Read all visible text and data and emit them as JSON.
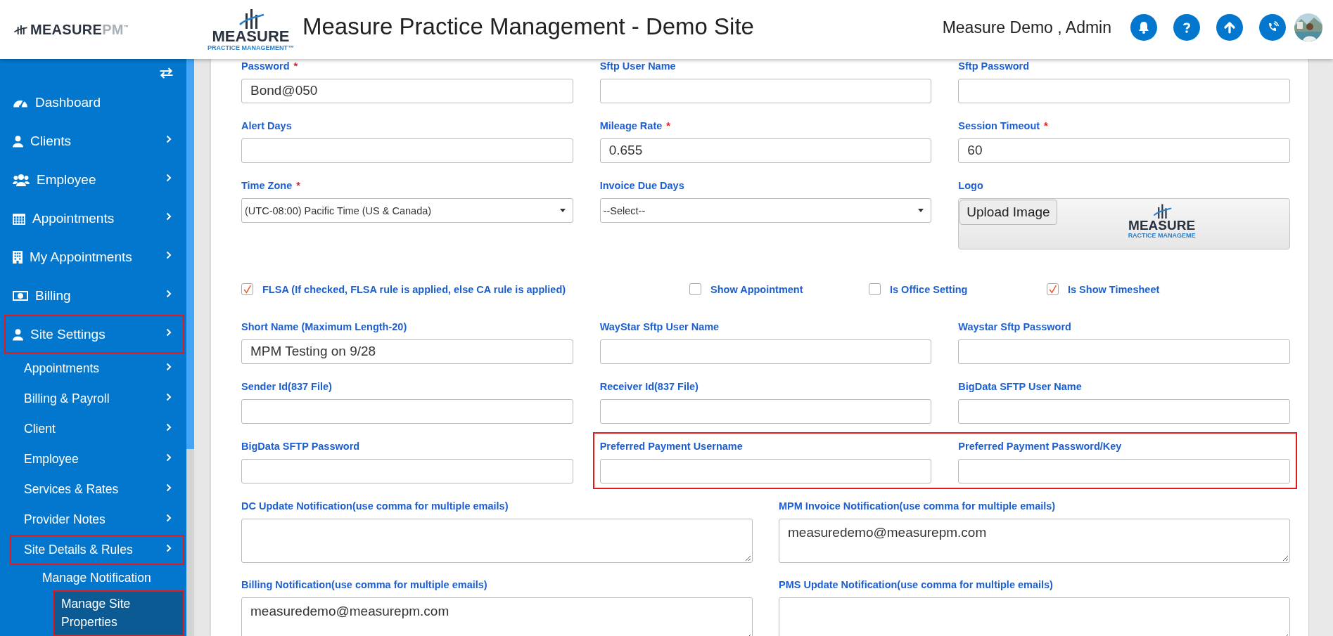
{
  "header": {
    "brand": "MEASURE",
    "brand_suffix": "PM",
    "brand_tm": "™",
    "logo_word": "MEASURE",
    "logo_sub": "PRACTICE MANAGEMENT™",
    "title": "Measure Practice Management - Demo Site",
    "user": "Measure Demo , Admin"
  },
  "sidebar": {
    "items": [
      {
        "label": "Dashboard",
        "has_submenu": false,
        "highlighted": false,
        "selected": false
      },
      {
        "label": "Clients",
        "has_submenu": true,
        "highlighted": false,
        "selected": false
      },
      {
        "label": "Employee",
        "has_submenu": true,
        "highlighted": false,
        "selected": false
      },
      {
        "label": "Appointments",
        "has_submenu": true,
        "highlighted": false,
        "selected": false
      },
      {
        "label": "My Appointments",
        "has_submenu": true,
        "highlighted": false,
        "selected": false
      },
      {
        "label": "Billing",
        "has_submenu": true,
        "highlighted": false,
        "selected": false
      },
      {
        "label": "Site Settings",
        "has_submenu": true,
        "highlighted": true,
        "selected": false,
        "children": [
          {
            "label": "Appointments",
            "has_submenu": true,
            "highlighted": false,
            "selected": false
          },
          {
            "label": "Billing & Payroll",
            "has_submenu": true,
            "highlighted": false,
            "selected": false
          },
          {
            "label": "Client",
            "has_submenu": true,
            "highlighted": false,
            "selected": false
          },
          {
            "label": "Employee",
            "has_submenu": true,
            "highlighted": false,
            "selected": false
          },
          {
            "label": "Services & Rates",
            "has_submenu": true,
            "highlighted": false,
            "selected": false
          },
          {
            "label": "Provider Notes",
            "has_submenu": true,
            "highlighted": false,
            "selected": false
          },
          {
            "label": "Site Details & Rules",
            "has_submenu": true,
            "highlighted": true,
            "selected": false,
            "children": [
              {
                "label": "Manage Notification",
                "has_submenu": false,
                "highlighted": false,
                "selected": false
              },
              {
                "label": "Manage Site Properties",
                "has_submenu": false,
                "highlighted": true,
                "selected": true
              }
            ]
          }
        ]
      }
    ]
  },
  "form": {
    "rows": [
      {
        "kind": "fields3",
        "fields": [
          {
            "kind": "input",
            "label": "Password",
            "required_mark": "*",
            "value": "Bond@050",
            "highlighted": false
          },
          {
            "kind": "input",
            "label": "Sftp User Name",
            "highlighted": false
          },
          {
            "kind": "input",
            "label": "Sftp Password",
            "highlighted": false
          }
        ]
      },
      {
        "kind": "fields3",
        "fields": [
          {
            "kind": "input",
            "label": "Alert Days",
            "highlighted": false
          },
          {
            "kind": "input",
            "label": "Mileage Rate",
            "required_mark": "*",
            "value": "0.655",
            "highlighted": false
          },
          {
            "kind": "input",
            "label": "Session Timeout",
            "required_mark": "*",
            "value": "60",
            "highlighted": false
          }
        ]
      },
      {
        "kind": "fields3",
        "fields": [
          {
            "kind": "select",
            "label": "Time Zone",
            "required_mark": "*",
            "value": "(UTC-08:00) Pacific Time (US & Canada)",
            "highlighted": false
          },
          {
            "kind": "select",
            "label": "Invoice Due Days",
            "value": "--Select--",
            "highlighted": false
          },
          {
            "kind": "logo",
            "label": "Logo",
            "button": "Upload Image",
            "logo_word": "MEASURE",
            "logo_sub": "RACTICE MANAGEME",
            "highlighted": false
          }
        ]
      },
      {
        "kind": "checkboxes",
        "fields": [
          {
            "label": "FLSA (If checked, FLSA rule is applied, else CA rule is applied)",
            "checked": true
          },
          {
            "label": "Show Appointment",
            "checked": false
          },
          {
            "label": "Is Office Setting",
            "checked": false
          },
          {
            "label": "Is Show Timesheet",
            "checked": true
          }
        ]
      },
      {
        "kind": "fields3",
        "fields": [
          {
            "kind": "input",
            "label": "Short Name (Maximum Length-20)",
            "value": "MPM Testing on 9/28",
            "highlighted": false
          },
          {
            "kind": "input",
            "label": "WayStar Sftp User Name",
            "highlighted": false
          },
          {
            "kind": "input",
            "label": "Waystar Sftp Password",
            "highlighted": false
          }
        ]
      },
      {
        "kind": "fields3",
        "fields": [
          {
            "kind": "input",
            "label": "Sender Id(837 File)",
            "highlighted": false
          },
          {
            "kind": "input",
            "label": "Receiver Id(837 File)",
            "highlighted": false
          },
          {
            "kind": "input",
            "label": "BigData SFTP User Name",
            "highlighted": false
          }
        ]
      },
      {
        "kind": "fields3",
        "fields": [
          {
            "kind": "input",
            "label": "BigData SFTP Password",
            "highlighted": false
          },
          {
            "kind": "input",
            "label": "Preferred Payment Username",
            "highlighted": true
          },
          {
            "kind": "input",
            "label": "Preferred Payment Password/Key",
            "highlighted": true
          }
        ]
      },
      {
        "kind": "fields2",
        "fields": [
          {
            "kind": "textarea",
            "label": "DC Update Notification(use comma for multiple emails)",
            "highlighted": false
          },
          {
            "kind": "textarea",
            "label": "MPM Invoice Notification(use comma for multiple emails)",
            "value": "measuredemo@measurepm.com",
            "highlighted": false
          }
        ]
      },
      {
        "kind": "fields2",
        "fields": [
          {
            "kind": "textarea",
            "label": "Billing Notification(use comma for multiple emails)",
            "value": "measuredemo@measurepm.com",
            "highlighted": false
          },
          {
            "kind": "textarea",
            "label": "PMS Update Notification(use comma for multiple emails)",
            "highlighted": false
          }
        ]
      }
    ]
  }
}
